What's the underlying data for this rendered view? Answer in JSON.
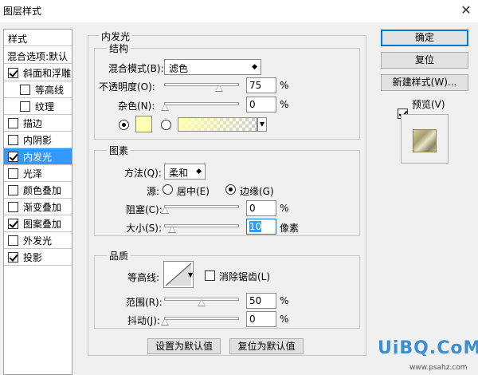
{
  "window": {
    "title": "图层样式",
    "close_icon": "close-icon"
  },
  "styles_panel": {
    "header": "样式",
    "blend_default": "混合选项:默认",
    "items": [
      {
        "label": "斜面和浮雕",
        "checked": true,
        "indent": false,
        "selected": false
      },
      {
        "label": "等高线",
        "checked": false,
        "indent": true,
        "selected": false
      },
      {
        "label": "纹理",
        "checked": false,
        "indent": true,
        "selected": false
      },
      {
        "label": "描边",
        "checked": false,
        "indent": false,
        "selected": false
      },
      {
        "label": "内阴影",
        "checked": false,
        "indent": false,
        "selected": false
      },
      {
        "label": "内发光",
        "checked": true,
        "indent": false,
        "selected": true
      },
      {
        "label": "光泽",
        "checked": false,
        "indent": false,
        "selected": false
      },
      {
        "label": "颜色叠加",
        "checked": false,
        "indent": false,
        "selected": false
      },
      {
        "label": "渐变叠加",
        "checked": false,
        "indent": false,
        "selected": false
      },
      {
        "label": "图案叠加",
        "checked": true,
        "indent": false,
        "selected": false
      },
      {
        "label": "外发光",
        "checked": false,
        "indent": false,
        "selected": false
      },
      {
        "label": "投影",
        "checked": true,
        "indent": false,
        "selected": false
      }
    ]
  },
  "inner_glow": {
    "title": "内发光",
    "structure": {
      "title": "结构",
      "blend_mode_label": "混合模式(B):",
      "blend_mode_value": "滤色",
      "opacity_label": "不透明度(O):",
      "opacity_value": "75",
      "noise_label": "杂色(N):",
      "noise_value": "0",
      "percent": "%",
      "glow_color": "#ffffb4",
      "gradient_start": "#ffffb4"
    },
    "elements": {
      "title": "图素",
      "technique_label": "方法(Q):",
      "technique_value": "柔和",
      "source_label": "源:",
      "source_center": "居中(E)",
      "source_edge": "边缘(G)",
      "choke_label": "阻塞(C):",
      "choke_value": "0",
      "size_label": "大小(S):",
      "size_value": "10",
      "size_unit": "像素",
      "percent": "%"
    },
    "quality": {
      "title": "品质",
      "contour_label": "等高线:",
      "anti_alias_label": "消除锯齿(L)",
      "range_label": "范围(R):",
      "range_value": "50",
      "jitter_label": "抖动(J):",
      "jitter_value": "0",
      "percent": "%"
    },
    "set_default": "设置为默认值",
    "reset_default": "复位为默认值"
  },
  "actions": {
    "ok": "确定",
    "reset": "复位",
    "new_style": "新建样式(W)...",
    "preview_label": "预览(V)",
    "preview_checked": true
  },
  "watermark": {
    "logo_text": "UiBQ.CoM",
    "url_text": "www.psahz.com"
  }
}
